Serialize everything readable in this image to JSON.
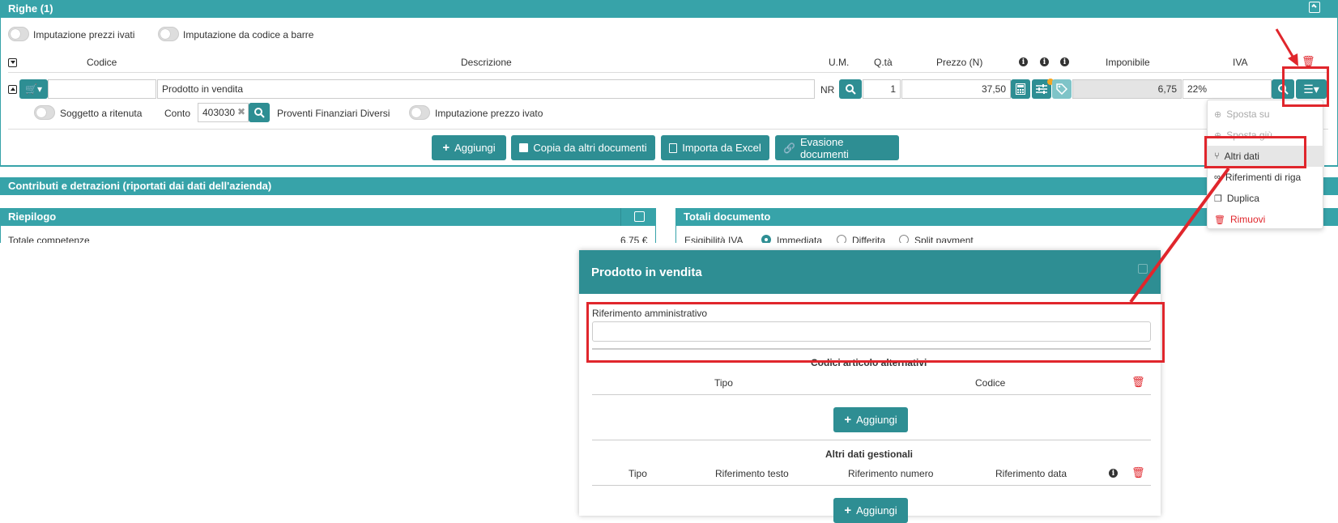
{
  "righe": {
    "title": "Righe (1)",
    "toggle1": "Imputazione prezzi ivati",
    "toggle2": "Imputazione da codice a barre",
    "columns": {
      "codice": "Codice",
      "descrizione": "Descrizione",
      "um": "U.M.",
      "qta": "Q.tà",
      "prezzo": "Prezzo (N)",
      "imponibile": "Imponibile",
      "iva": "IVA"
    },
    "row": {
      "descrizione": "Prodotto in vendita",
      "um": "NR",
      "qta": "1",
      "prezzo": "37,50",
      "imponibile": "6,75",
      "iva": "22%",
      "soggetto_ritenuta": "Soggetto a ritenuta",
      "conto_label": "Conto",
      "conto_value": "403030",
      "conto_desc": "Proventi Finanziari Diversi",
      "imputazione_prezzo_ivato": "Imputazione prezzo ivato"
    },
    "buttons": {
      "aggiungi": "Aggiungi",
      "copia": "Copia da altri documenti",
      "importa": "Importa da Excel",
      "evasione": "Evasione documenti"
    }
  },
  "menu": {
    "items": [
      "Sposta su",
      "Sposta giù",
      "Altri dati",
      "Riferimenti di riga",
      "Duplica",
      "Rimuovi"
    ]
  },
  "contributi": {
    "title": "Contributi e detrazioni (riportati dai dati dell'azienda)"
  },
  "riepilogo": {
    "title": "Riepilogo",
    "row_label": "Totale competenze",
    "row_value": "6,75 €"
  },
  "totali": {
    "title": "Totali documento",
    "esigibilita": "Esigibilità IVA",
    "opt1": "Immediata",
    "opt2": "Differita",
    "opt3": "Split payment"
  },
  "modal": {
    "title": "Prodotto in vendita",
    "rif_label": "Riferimento amministrativo",
    "codici_title": "Codici articolo alternativi",
    "codici_cols": [
      "Tipo",
      "Codice"
    ],
    "aggiungi": "Aggiungi",
    "altri_title": "Altri dati gestionali",
    "altri_cols": [
      "Tipo",
      "Riferimento testo",
      "Riferimento numero",
      "Riferimento data"
    ]
  },
  "colors": {
    "teal": "#37a3a9",
    "teal_dark": "#2e8e93",
    "red": "#e0262c"
  }
}
